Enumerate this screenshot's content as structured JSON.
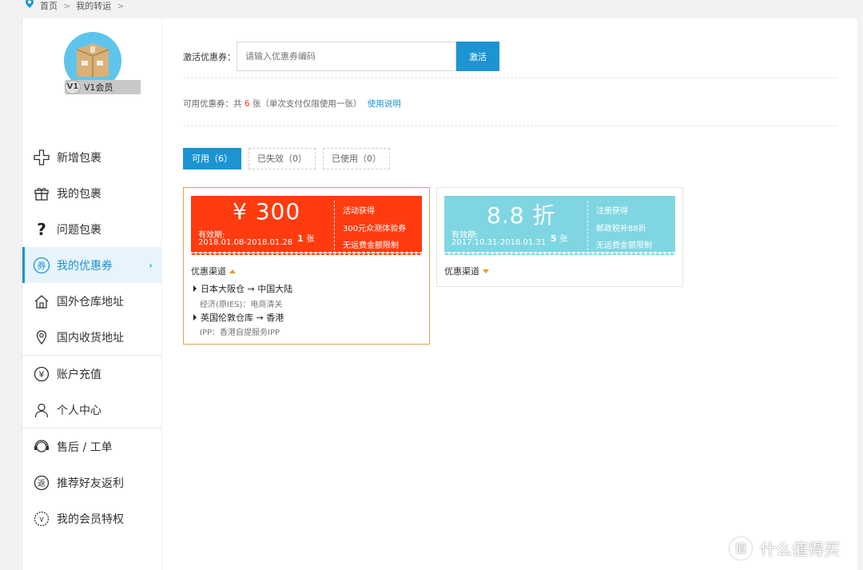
{
  "breadcrumb": {
    "home": "首页",
    "current": "我的转运"
  },
  "user": {
    "level_icon": "V1",
    "level_label": "V1会员"
  },
  "sidebar": {
    "items": [
      {
        "label": "新增包裹",
        "icon": "plus-icon"
      },
      {
        "label": "我的包裹",
        "icon": "gift-box-icon"
      },
      {
        "label": "问题包裹",
        "icon": "question-icon"
      },
      {
        "label": "我的优惠券",
        "icon": "coupon-icon",
        "active": true
      },
      {
        "label": "国外仓库地址",
        "icon": "house-icon"
      },
      {
        "label": "国内收货地址",
        "icon": "location-pin-icon"
      },
      {
        "label": "账户充值",
        "icon": "yen-icon"
      },
      {
        "label": "个人中心",
        "icon": "person-icon"
      },
      {
        "label": "售后 / 工单",
        "icon": "headset-icon"
      },
      {
        "label": "推荐好友返利",
        "icon": "rebate-icon"
      },
      {
        "label": "我的会员特权",
        "icon": "vip-badge-icon"
      }
    ]
  },
  "activate": {
    "label": "激活优惠券：",
    "placeholder": "请输入优惠券编码",
    "button": "激活"
  },
  "available": {
    "prefix": "可用优惠券：共",
    "count": "6",
    "suffix": "张（单次支付仅限使用一张）",
    "link": "使用说明"
  },
  "tabs": [
    {
      "label": "可用（6）",
      "active": true
    },
    {
      "label": "已失效（0）"
    },
    {
      "label": "已使用（0）"
    }
  ],
  "coupons": [
    {
      "amount": "¥ 300",
      "valid_label": "有效期:",
      "valid": "2018.01.08-2018.01.28",
      "count": "1",
      "count_unit": "张",
      "source": "活动获得",
      "desc": "300元众测体验券",
      "limit": "无运费金额限制",
      "channel_label": "优惠渠道",
      "routes": [
        {
          "route": "日本大阪仓 → 中国大陆",
          "detail": "经济(原IES)：电商清关"
        },
        {
          "route": "英国伦敦仓库 → 香港",
          "detail": "IPP：香港自提服务IPP"
        }
      ],
      "color": "#ff3b0f"
    },
    {
      "amount": "8.8 折",
      "valid_label": "有效期:",
      "valid": "2017.10.31-2018.01.31",
      "count": "5",
      "count_unit": "张",
      "source": "注册获得",
      "desc": "邮政税补88折",
      "limit": "无运费金额限制",
      "channel_label": "优惠渠道",
      "color": "#7fd6e2"
    }
  ],
  "watermark": {
    "text": "什么值得买",
    "icon": "值"
  },
  "colors": {
    "accent": "#1c94d2",
    "highlight": "#ff3b1f",
    "coupon_red": "#ff3b0f",
    "coupon_cyan": "#7fd6e2",
    "gold_border": "#e0a54b"
  }
}
